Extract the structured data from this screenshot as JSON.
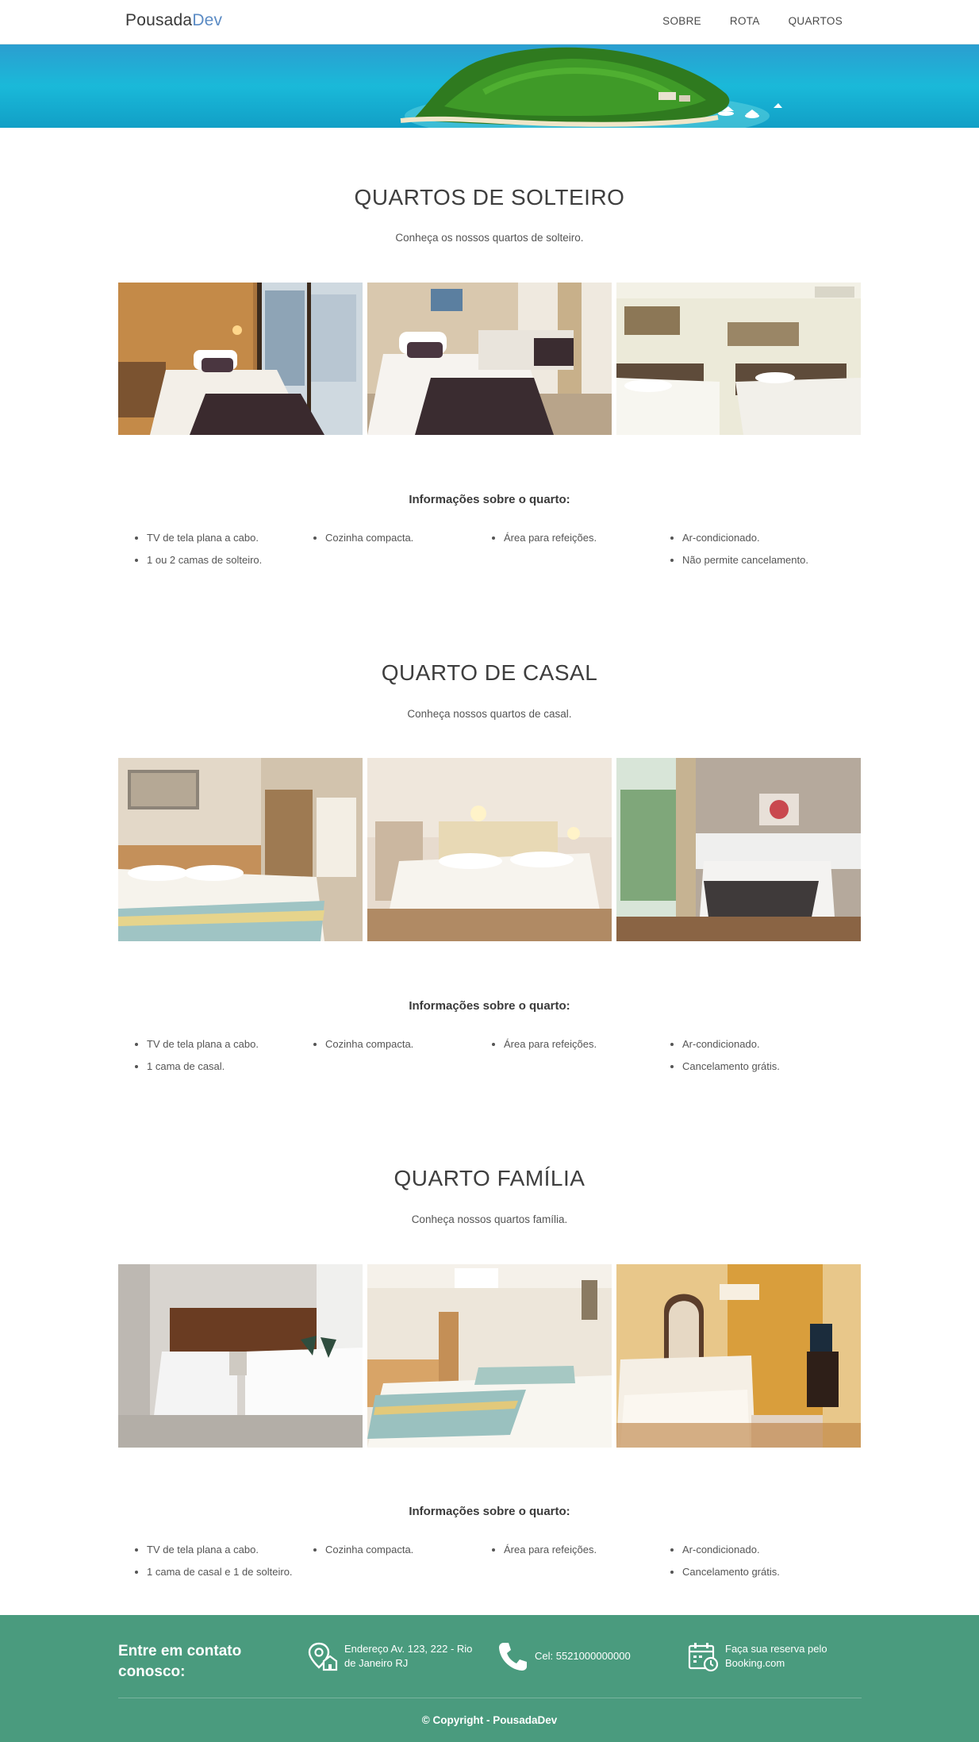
{
  "navbar": {
    "brand_main": "Pousada",
    "brand_accent": "Dev",
    "links": [
      "SOBRE",
      "ROTA",
      "QUARTOS"
    ]
  },
  "colors": {
    "brand_accent": "#5b8bc4",
    "footer_bg": "#4a9b7e"
  },
  "sections": [
    {
      "title": "QUARTOS DE SOLTEIRO",
      "subtitle": "Conheça os nossos quartos de solteiro.",
      "info_title": "Informações sobre o quarto:",
      "info_columns": [
        [
          "TV de tela plana a cabo.",
          "1 ou 2 camas de solteiro."
        ],
        [
          "Cozinha compacta."
        ],
        [
          "Área para refeições."
        ],
        [
          "Ar-condicionado.",
          "Não permite cancelamento."
        ]
      ]
    },
    {
      "title": "QUARTO DE CASAL",
      "subtitle": "Conheça nossos quartos de casal.",
      "info_title": "Informações sobre o quarto:",
      "info_columns": [
        [
          "TV de tela plana a cabo.",
          "1 cama de casal."
        ],
        [
          "Cozinha compacta."
        ],
        [
          "Área para refeições."
        ],
        [
          "Ar-condicionado.",
          "Cancelamento grátis."
        ]
      ]
    },
    {
      "title": "QUARTO FAMÍLIA",
      "subtitle": "Conheça nossos quartos família.",
      "info_title": "Informações sobre o quarto:",
      "info_columns": [
        [
          "TV de tela plana a cabo.",
          "1 cama de casal e 1 de solteiro."
        ],
        [
          "Cozinha compacta."
        ],
        [
          "Área para refeições."
        ],
        [
          "Ar-condicionado.",
          "Cancelamento grátis."
        ]
      ]
    }
  ],
  "footer": {
    "contact_title": "Entre em contato conosco:",
    "address": "Endereço Av. 123, 222 - Rio de Janeiro RJ",
    "phone": "Cel: 5521000000000",
    "booking": "Faça sua reserva pelo Booking.com",
    "copyright": "© Copyright - PousadaDev",
    "icons": [
      "location-icon",
      "phone-icon",
      "calendar-icon"
    ]
  }
}
